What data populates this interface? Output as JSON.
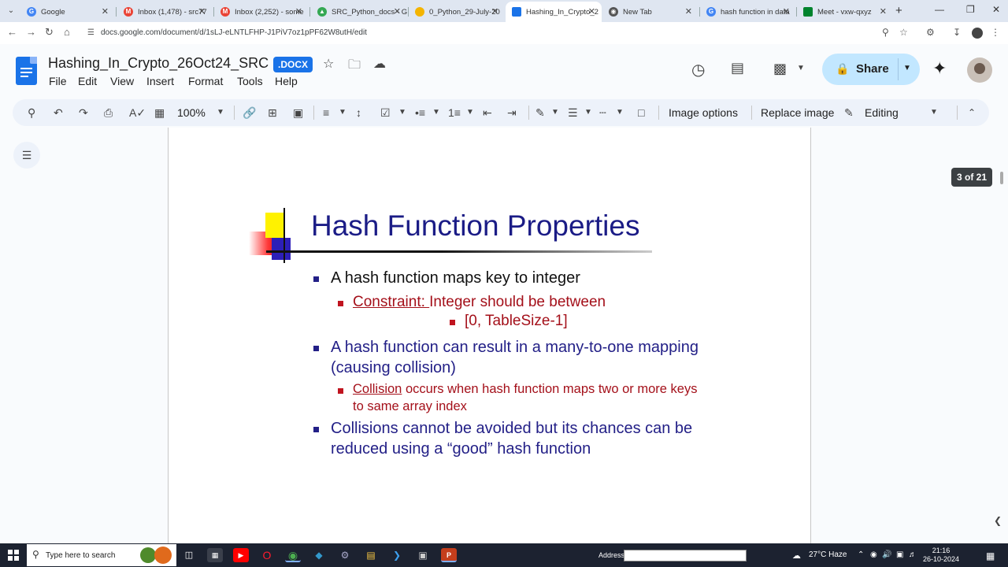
{
  "browser": {
    "tabs": [
      {
        "title": "Google",
        "icon": "google-icon",
        "color": "#4285f4",
        "active": false
      },
      {
        "title": "Inbox (1,478) - src77",
        "icon": "gmail-icon",
        "color": "#ea4335",
        "active": false
      },
      {
        "title": "Inbox (2,252) - some",
        "icon": "gmail-icon",
        "color": "#ea4335",
        "active": false
      },
      {
        "title": "SRC_Python_docs - G",
        "icon": "drive-icon",
        "color": "#34a853",
        "active": false
      },
      {
        "title": "0_Python_29-July-20",
        "icon": "folder-icon",
        "color": "#f4b400",
        "active": false
      },
      {
        "title": "Hashing_In_Crypto_2",
        "icon": "docs-icon",
        "color": "#1a73e8",
        "active": true
      },
      {
        "title": "New Tab",
        "icon": "chrome-icon",
        "color": "#555555",
        "active": false
      },
      {
        "title": "hash function in data",
        "icon": "google-icon",
        "color": "#4285f4",
        "active": false
      },
      {
        "title": "Meet - vxw-qxyz",
        "icon": "meet-icon",
        "color": "#00832d",
        "active": false
      }
    ],
    "url": "docs.google.com/document/d/1sLJ-eLNTLFHP-J1PiV7oz1pPF62W8utH/edit"
  },
  "doc": {
    "title": "Hashing_In_Crypto_26Oct24_SRC",
    "badge": ".DOCX",
    "menus": [
      "File",
      "Edit",
      "View",
      "Insert",
      "Format",
      "Tools",
      "Help"
    ],
    "share_label": "Share"
  },
  "toolbar": {
    "zoom": "100%",
    "image_options": "Image options",
    "replace_image": "Replace image",
    "mode": "Editing"
  },
  "page_indicator": "3 of 21",
  "slide": {
    "title": "Hash Function Properties",
    "bullet1": "A hash function maps key to integer",
    "sub1_link": "Constraint: ",
    "sub1_text": "Integer should be between",
    "sub1_line2": "[0, TableSize-1]",
    "bullet2_line1": "A hash function can result in a many-to-one mapping",
    "bullet2_line2": "(causing collision)",
    "sub2_link": "Collision",
    "sub2_text": " occurs when hash function maps two or more keys",
    "sub2_line2": "to same array index",
    "bullet3_line1": "Collisions cannot be avoided but its chances can be",
    "bullet3_line2": "reduced using a “good” hash function"
  },
  "taskbar": {
    "search_placeholder": "Type here to search",
    "address_label": "Address",
    "weather": "27°C  Haze",
    "time": "21:16",
    "date": "26-10-2024"
  }
}
